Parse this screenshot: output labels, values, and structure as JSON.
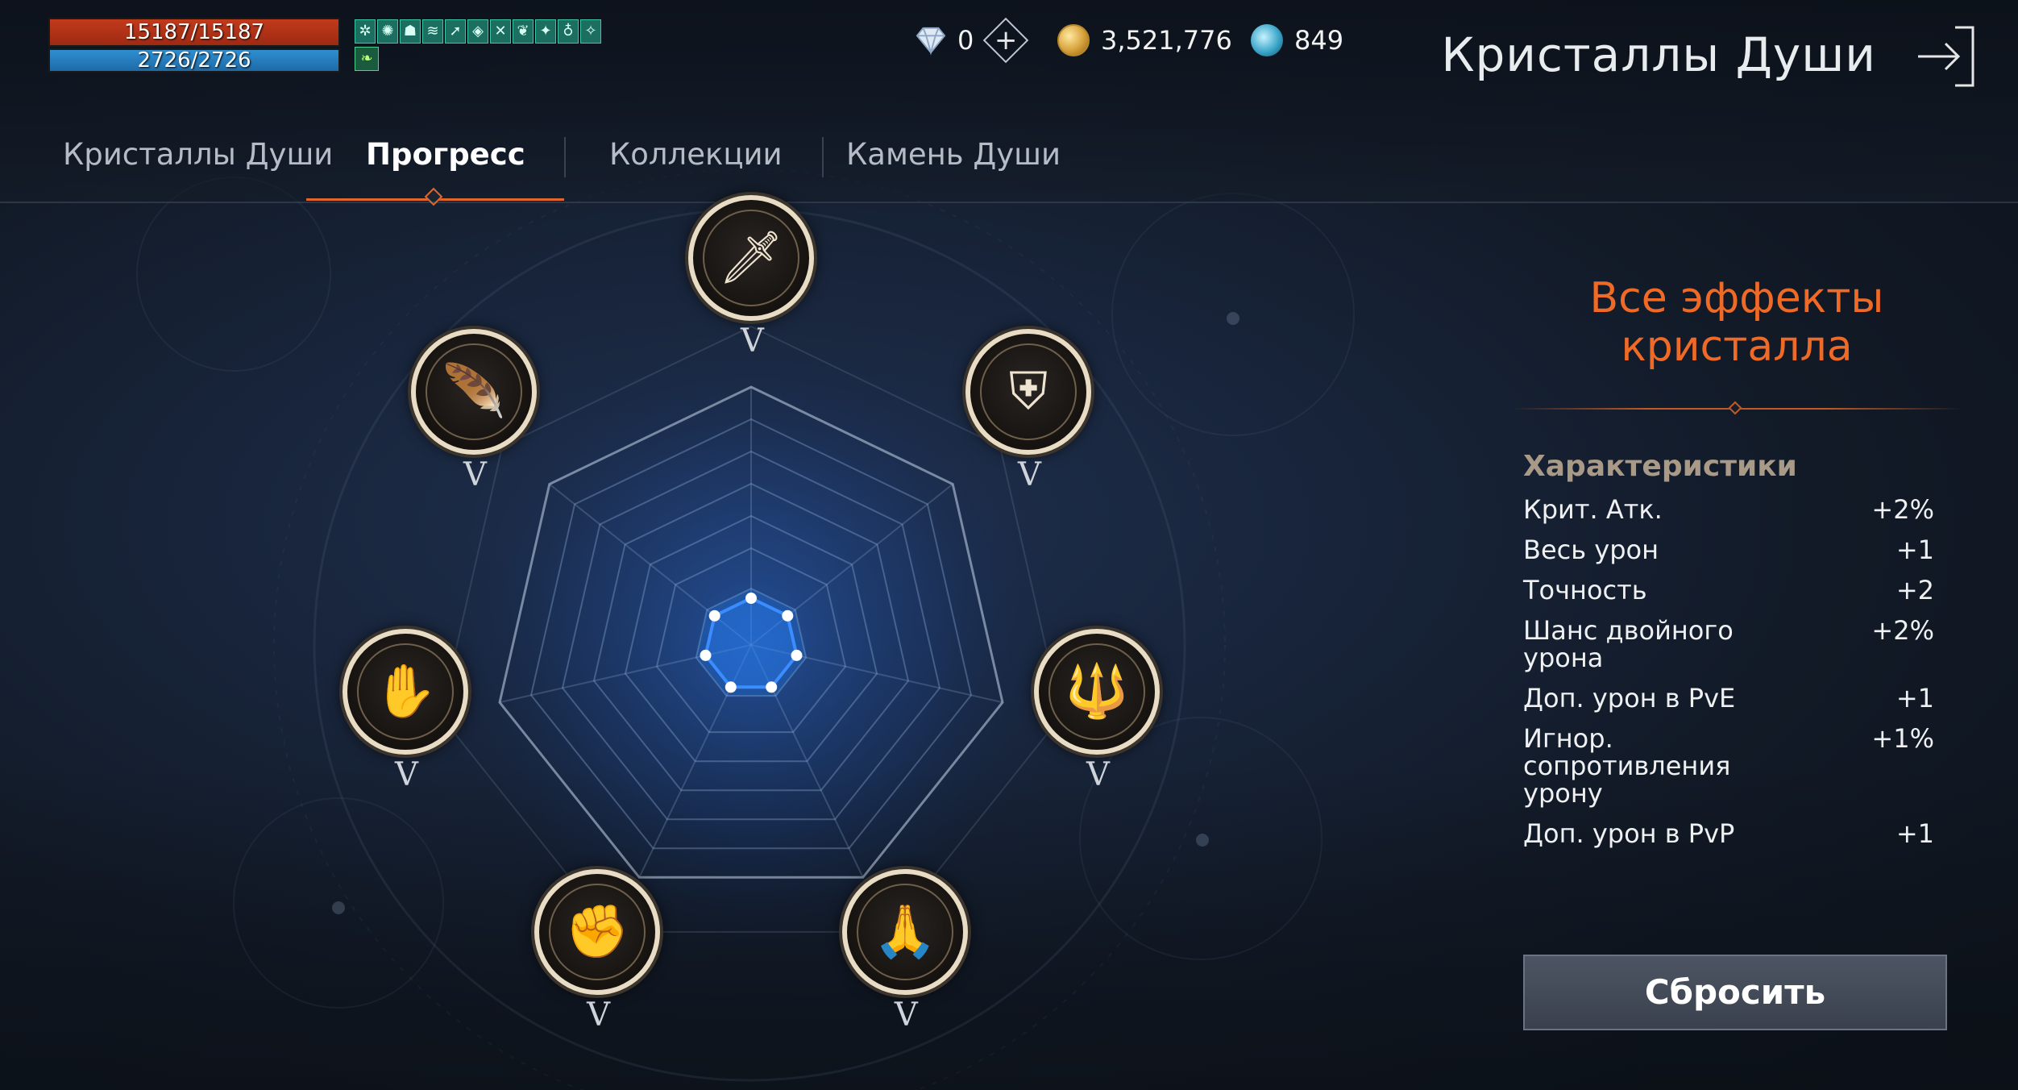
{
  "player": {
    "hp": "15187/15187",
    "mp": "2726/2726",
    "buff_icons": [
      "snowflake-icon",
      "sun-icon",
      "skull-icon",
      "wind-icon",
      "arrow-icon",
      "shield-icon",
      "cross-swords-icon",
      "leaf-icon",
      "flame-icon",
      "flask-icon",
      "swirl-icon"
    ],
    "buff_icons2": [
      "green-leaf-icon"
    ]
  },
  "currencies": {
    "diamonds": "0",
    "gold": "3,521,776",
    "soul_points": "849"
  },
  "window": {
    "title": "Кристаллы Души"
  },
  "tabs": [
    {
      "label": "Кристаллы Души",
      "active": false
    },
    {
      "label": "Прогресс",
      "active": true
    },
    {
      "label": "Коллекции",
      "active": false
    },
    {
      "label": "Камень Души",
      "active": false
    }
  ],
  "radar": {
    "nodes": [
      {
        "name": "dagger",
        "icon": "dagger-icon",
        "glyph": "🗡",
        "level": "V"
      },
      {
        "name": "shield-emblem",
        "icon": "shield-emblem-icon",
        "glyph": "⛨",
        "level": "V"
      },
      {
        "name": "trident-book",
        "icon": "trident-book-icon",
        "glyph": "🔱",
        "level": "V"
      },
      {
        "name": "praying-hands",
        "icon": "praying-hands-icon",
        "glyph": "🙏",
        "level": "V"
      },
      {
        "name": "fist",
        "icon": "fist-icon",
        "glyph": "✊",
        "level": "V"
      },
      {
        "name": "winged-fists",
        "icon": "winged-fists-icon",
        "glyph": "✋",
        "level": "V"
      },
      {
        "name": "feathers",
        "icon": "feathers-icon",
        "glyph": "🪶",
        "level": "V"
      }
    ]
  },
  "panel": {
    "title_line1": "Все эффекты",
    "title_line2": "кристалла",
    "stats_heading": "Характеристики",
    "stats": [
      {
        "name": "Крит. Атк.",
        "value": "+2%"
      },
      {
        "name": "Весь урон",
        "value": "+1"
      },
      {
        "name": "Точность",
        "value": "+2"
      },
      {
        "name": "Шанс двойного урона",
        "value": "+2%"
      },
      {
        "name": "Доп. урон в PvE",
        "value": "+1"
      },
      {
        "name": "Игнор. сопротивления урону",
        "value": "+1%"
      },
      {
        "name": "Доп. урон в PvP",
        "value": "+1"
      }
    ],
    "reset_label": "Сбросить"
  },
  "colors": {
    "accent": "#e0662a",
    "hp": "#c23a1c",
    "mp": "#2f8fd0",
    "radar_fill": "#1e6fd6"
  }
}
